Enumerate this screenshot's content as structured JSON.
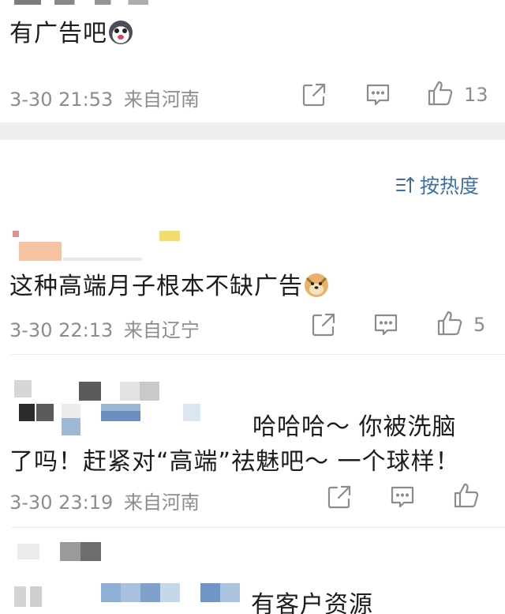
{
  "comments": [
    {
      "text": "有广告吧",
      "emoji": "husky-emoji",
      "timestamp": "3-30 21:53",
      "location": "来自河南",
      "likes": "13"
    },
    {
      "text": "这种高端月子根本不缺广告",
      "emoji": "doge-emoji",
      "timestamp": "3-30 22:13",
      "location": "来自辽宁",
      "likes": "5"
    },
    {
      "text_line1": "哈哈哈～ 你被洗脑",
      "text_line2": "了吗！赶紧对“高端”祛魅吧～ 一个球样！",
      "timestamp": "3-30 23:19",
      "location": "来自河南",
      "likes": ""
    },
    {
      "text": "有客户资源"
    }
  ],
  "sort": {
    "label": "按热度",
    "icon": "sort-icon"
  },
  "colors": {
    "accent": "#3f6fa6",
    "meta": "#8c8c8c",
    "separator_band": "#efefef"
  }
}
